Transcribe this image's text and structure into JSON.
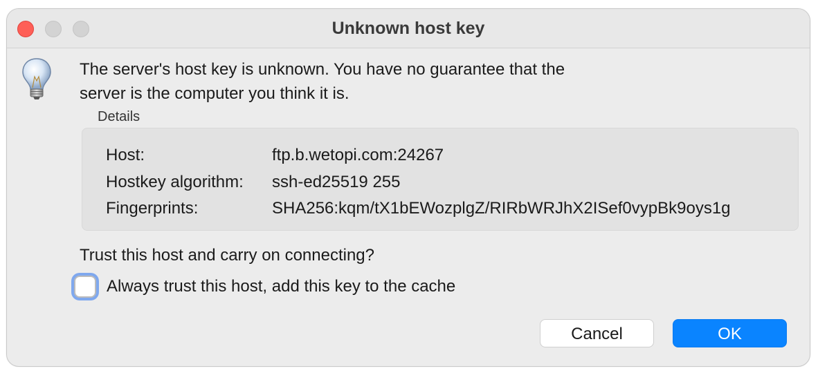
{
  "window": {
    "title": "Unknown host key"
  },
  "message": {
    "line1": "The server's host key is unknown. You have no guarantee that the",
    "line2": "server is the computer you think it is."
  },
  "details": {
    "label": "Details",
    "rows": [
      {
        "key": "Host:",
        "value": "ftp.b.wetopi.com:24267"
      },
      {
        "key": "Hostkey algorithm:",
        "value": "ssh-ed25519 255"
      },
      {
        "key": "Fingerprints:",
        "value": "SHA256:kqm/tX1bEWozplgZ/RIRbWRJhX2ISef0vypBk9oys1g"
      }
    ]
  },
  "prompt": {
    "question": "Trust this host and carry on connecting?",
    "checkbox_label": "Always trust this host, add this key to the cache",
    "checkbox_checked": false
  },
  "buttons": {
    "cancel": "Cancel",
    "ok": "OK"
  },
  "icons": {
    "info": "lightbulb-icon"
  },
  "colors": {
    "accent": "#0a84ff",
    "close_button": "#fe5f57",
    "focus_ring": "#7fa8ee"
  }
}
